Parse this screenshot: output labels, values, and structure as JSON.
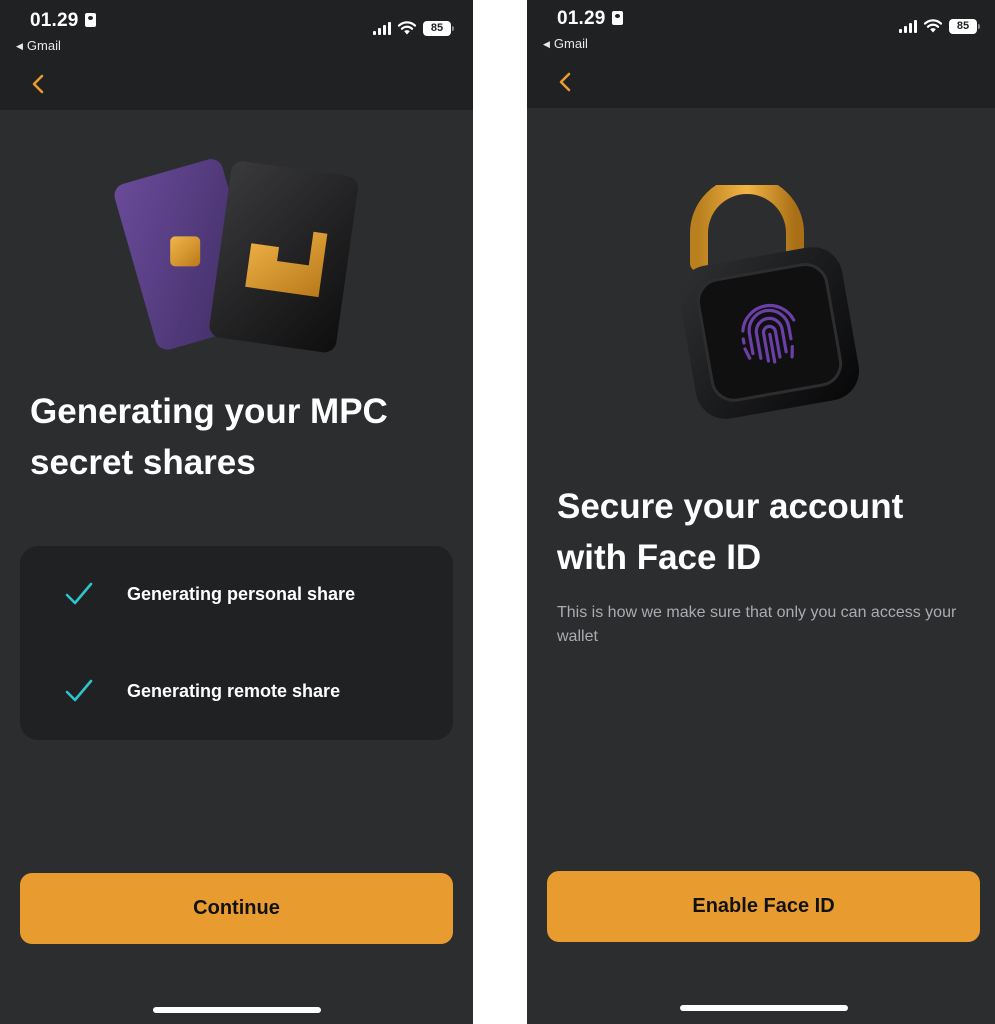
{
  "screens": [
    {
      "status": {
        "time": "01.29",
        "back_app": "Gmail",
        "battery": "85"
      },
      "title_line1": "Generating your MPC",
      "title_line2": "secret shares",
      "tasks": [
        {
          "label": "Generating personal share",
          "done": true
        },
        {
          "label": "Generating remote share",
          "done": true
        }
      ],
      "button_label": "Continue"
    },
    {
      "status": {
        "time": "01.29",
        "back_app": "Gmail",
        "battery": "85"
      },
      "title_line1": "Secure your account",
      "title_line2": "with Face ID",
      "subtitle": "This is how we make sure that only you can access your wallet",
      "button_label": "Enable Face ID"
    }
  ],
  "colors": {
    "accent": "#e89c30",
    "check": "#2ec4cc",
    "background": "#2b2d2f",
    "header_background": "#1f2123",
    "card_background": "#1f2123",
    "text_primary": "#ffffff",
    "text_secondary": "#a9acb0"
  },
  "icons": {
    "back": "chevron-left-icon",
    "check": "checkmark-icon",
    "screen1_illustration": "cards-illustration",
    "screen2_illustration": "fingerprint-padlock-illustration"
  }
}
